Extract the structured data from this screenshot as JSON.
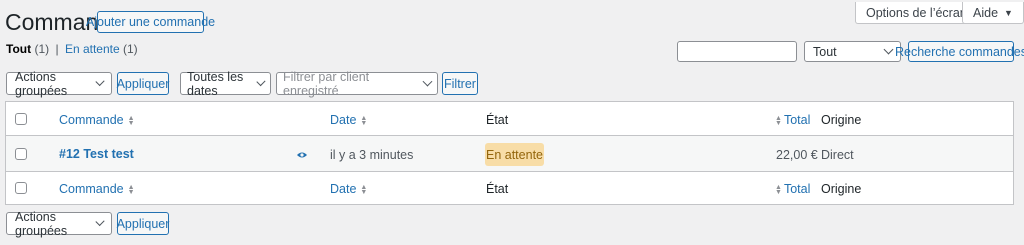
{
  "header": {
    "title": "Commandes",
    "add_order_label": "Ajouter une commande",
    "screen_options_label": "Options de l’écran",
    "help_label": "Aide"
  },
  "views": {
    "all_label": "Tout",
    "all_count": "(1)",
    "separator": "|",
    "pending_label": "En attente",
    "pending_count": "(1)"
  },
  "search": {
    "value": "",
    "status_select": "Tout",
    "button_label": "Recherche commandes"
  },
  "tablenav_top": {
    "bulk_select": "Actions groupées",
    "apply_label": "Appliquer",
    "dates_select": "Toutes les dates",
    "customer_placeholder": "Filtrer par client enregistré",
    "filter_label": "Filtrer"
  },
  "columns": {
    "order": "Commande",
    "date": "Date",
    "status": "État",
    "total": "Total",
    "origin": "Origine"
  },
  "orders": [
    {
      "label": "#12 Test test",
      "date": "il y a 3 minutes",
      "status": "En attente",
      "total": "22,00 €",
      "origin": "Direct"
    }
  ],
  "tablenav_bottom": {
    "bulk_select": "Actions groupées",
    "apply_label": "Appliquer"
  },
  "colors": {
    "accent": "#2271b1",
    "pending_bg": "#f8dda7",
    "pending_text": "#94660c"
  },
  "icons": {
    "preview": "eye-icon",
    "sort": "sort-arrows-icon",
    "dropdown": "chevron-down-icon"
  }
}
